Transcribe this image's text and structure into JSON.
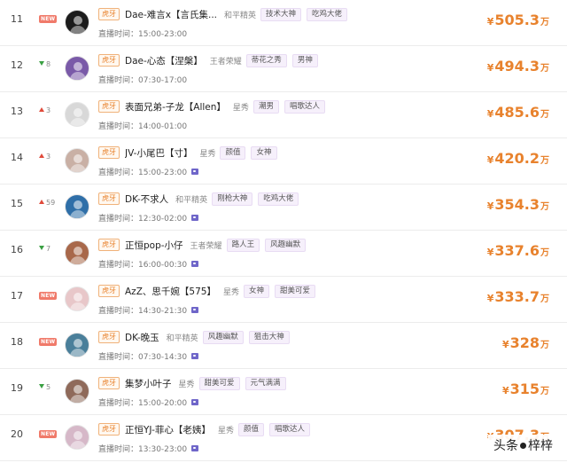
{
  "rows": [
    {
      "rank": "11",
      "change": {
        "type": "new",
        "label": "NEW"
      },
      "platform": "虎牙",
      "name": "Dae-难言x【言氏集...",
      "category": "和平精英",
      "tags": [
        "技术大神",
        "吃鸡大佬"
      ],
      "time": "直播时间：15:00-23:00",
      "video": false,
      "currency": "¥",
      "amount": "505.3",
      "unit": "万",
      "avatar_color": "#1c1c1c"
    },
    {
      "rank": "12",
      "change": {
        "type": "down",
        "value": "8"
      },
      "platform": "虎牙",
      "name": "Dae-心态【涅槃】",
      "category": "王者荣耀",
      "tags": [
        "蒂花之秀",
        "男神"
      ],
      "time": "直播时间：07:30-17:00",
      "video": false,
      "currency": "¥",
      "amount": "494.3",
      "unit": "万",
      "avatar_color": "#7a5aa8"
    },
    {
      "rank": "13",
      "change": {
        "type": "up",
        "value": "3"
      },
      "platform": "虎牙",
      "name": "表面兄弟-子龙【Allen】",
      "category": "星秀",
      "tags": [
        "潮男",
        "唱歌达人"
      ],
      "time": "直播时间：14:00-01:00",
      "video": false,
      "currency": "¥",
      "amount": "485.6",
      "unit": "万",
      "avatar_color": "#d8d8d8"
    },
    {
      "rank": "14",
      "change": {
        "type": "up",
        "value": "3"
      },
      "platform": "虎牙",
      "name": "JV-小尾巴【寸】",
      "category": "星秀",
      "tags": [
        "颜值",
        "女神"
      ],
      "time": "直播时间：15:00-23:00",
      "video": true,
      "currency": "¥",
      "amount": "420.2",
      "unit": "万",
      "avatar_color": "#c9b0a5"
    },
    {
      "rank": "15",
      "change": {
        "type": "up",
        "value": "59"
      },
      "platform": "虎牙",
      "name": "DK-不求人",
      "category": "和平精英",
      "tags": [
        "刚枪大神",
        "吃鸡大佬"
      ],
      "time": "直播时间：12:30-02:00",
      "video": true,
      "currency": "¥",
      "amount": "354.3",
      "unit": "万",
      "avatar_color": "#2f6fa8"
    },
    {
      "rank": "16",
      "change": {
        "type": "down",
        "value": "7"
      },
      "platform": "虎牙",
      "name": "正恒pop-小仔",
      "category": "王者荣耀",
      "tags": [
        "路人王",
        "风趣幽默"
      ],
      "time": "直播时间：16:00-00:30",
      "video": true,
      "currency": "¥",
      "amount": "337.6",
      "unit": "万",
      "avatar_color": "#a8684a"
    },
    {
      "rank": "17",
      "change": {
        "type": "new",
        "label": "NEW"
      },
      "platform": "虎牙",
      "name": "AzZ、思千婉【575】",
      "category": "星秀",
      "tags": [
        "女神",
        "甜美可爱"
      ],
      "time": "直播时间：14:30-21:30",
      "video": true,
      "currency": "¥",
      "amount": "333.7",
      "unit": "万",
      "avatar_color": "#e8c7c9"
    },
    {
      "rank": "18",
      "change": {
        "type": "new",
        "label": "NEW"
      },
      "platform": "虎牙",
      "name": "DK-晚玉",
      "category": "和平精英",
      "tags": [
        "风趣幽默",
        "狙击大神"
      ],
      "time": "直播时间：07:30-14:30",
      "video": true,
      "currency": "¥",
      "amount": "328",
      "unit": "万",
      "avatar_color": "#4a7f9a"
    },
    {
      "rank": "19",
      "change": {
        "type": "down",
        "value": "5"
      },
      "platform": "虎牙",
      "name": "集梦小叶子",
      "category": "星秀",
      "tags": [
        "甜美可爱",
        "元气满满"
      ],
      "time": "直播时间：15:00-20:00",
      "video": true,
      "currency": "¥",
      "amount": "315",
      "unit": "万",
      "avatar_color": "#8f6a5a"
    },
    {
      "rank": "20",
      "change": {
        "type": "new",
        "label": "NEW"
      },
      "platform": "虎牙",
      "name": "正恒YJ-菲心【老姨】",
      "category": "星秀",
      "tags": [
        "颜值",
        "唱歌达人"
      ],
      "time": "直播时间：13:30-23:00",
      "video": true,
      "currency": "¥",
      "amount": "307.3",
      "unit": "万",
      "avatar_color": "#d6b8c8"
    }
  ],
  "watermark": {
    "prefix": "头条",
    "handle": "梓梓"
  }
}
